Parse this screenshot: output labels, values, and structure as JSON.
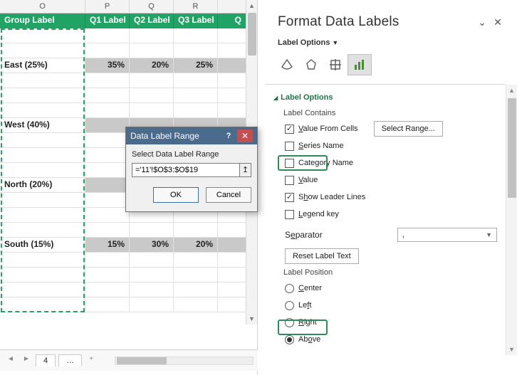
{
  "sheet": {
    "col_letters": [
      "O",
      "P",
      "Q",
      "R"
    ],
    "headers": {
      "group": "Group Label",
      "q1": "Q1 Label",
      "q2": "Q2 Label",
      "q3": "Q3 Label",
      "q4partial": "Q"
    },
    "rows": {
      "east": {
        "label": "East (25%)",
        "q1": "35%",
        "q2": "20%",
        "q3": "25%"
      },
      "west": {
        "label": "West (40%)",
        "q1": "",
        "q2": "",
        "q3": ""
      },
      "north": {
        "label": "North (20%)",
        "q1": "",
        "q2": "",
        "q3": ""
      },
      "south": {
        "label": "South (15%)",
        "q1": "15%",
        "q2": "30%",
        "q3": "20%"
      }
    },
    "tab_left": "4",
    "tab_name": "…",
    "add_tab": "+"
  },
  "dialog": {
    "title": "Data Label Range",
    "help": "?",
    "close": "✕",
    "prompt": "Select Data Label Range",
    "value": "='11'!$O$3:$O$19",
    "collapse_glyph": "↥",
    "ok": "OK",
    "cancel": "Cancel"
  },
  "pane": {
    "title": "Format Data Labels",
    "expand": "⌄",
    "close": "✕",
    "subtitle": "Label Options",
    "section": "Label Options",
    "contains_head": "Label Contains",
    "value_from_cells": "Value From Cells",
    "select_range": "Select Range...",
    "series_name": "Series Name",
    "category_name": "Category Name",
    "value": "Value",
    "leader_lines": "Show Leader Lines",
    "legend_key": "Legend key",
    "separator_label": "Separator",
    "separator_value": ",",
    "reset": "Reset Label Text",
    "position_head": "Label Position",
    "pos_center": "Center",
    "pos_left": "Left",
    "pos_right": "Right",
    "pos_above": "Above"
  },
  "underlined": {
    "value_from_cells": "V",
    "series_name": "S",
    "category_name": "C",
    "value": "V",
    "leader_lines": "h",
    "legend_key": "L",
    "separator": "e",
    "pos_center": "C",
    "pos_left": "L",
    "pos_right": "R",
    "pos_above": "A"
  }
}
